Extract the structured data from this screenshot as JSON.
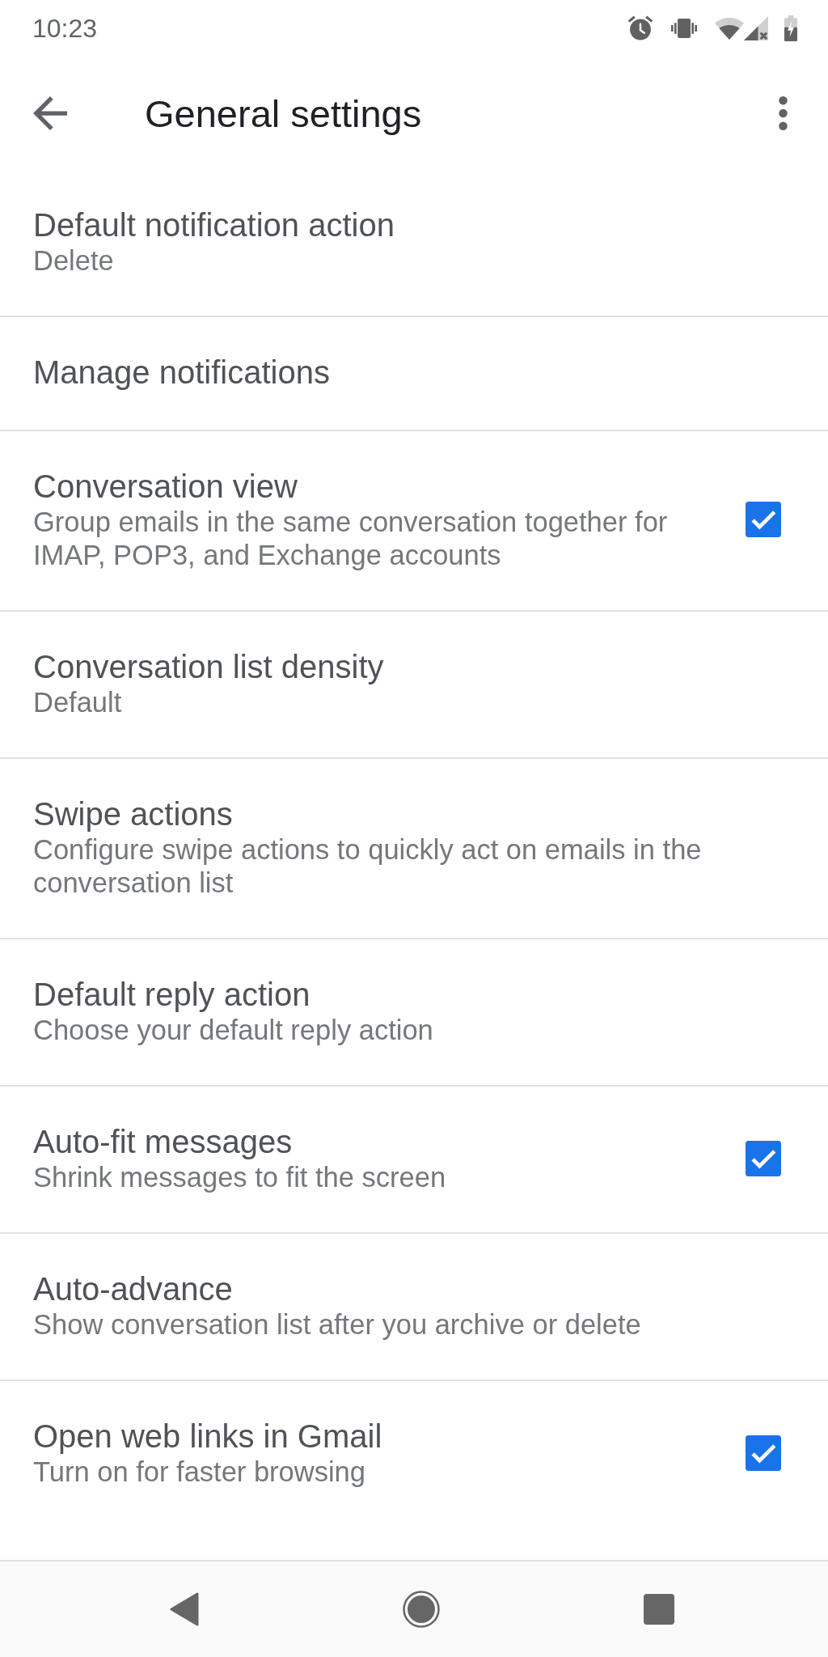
{
  "status_bar": {
    "time": "10:23"
  },
  "app_bar": {
    "title": "General settings"
  },
  "settings": [
    {
      "kind": "text",
      "title": "Default notification action",
      "summary": "Delete"
    },
    {
      "kind": "text",
      "title": "Manage notifications"
    },
    {
      "kind": "checkbox",
      "title": "Conversation view",
      "summary": "Group emails in the same conversation together for IMAP, POP3, and Exchange accounts",
      "checked": true
    },
    {
      "kind": "text",
      "title": "Conversation list density",
      "summary": "Default"
    },
    {
      "kind": "text",
      "title": "Swipe actions",
      "summary": "Configure swipe actions to quickly act on emails in the conversation list"
    },
    {
      "kind": "text",
      "title": "Default reply action",
      "summary": "Choose your default reply action"
    },
    {
      "kind": "checkbox",
      "title": "Auto-fit messages",
      "summary": "Shrink messages to fit the screen",
      "checked": true
    },
    {
      "kind": "text",
      "title": "Auto-advance",
      "summary": "Show conversation list after you archive or delete"
    },
    {
      "kind": "checkbox",
      "title": "Open web links in Gmail",
      "summary": "Turn on for faster browsing",
      "checked": true
    }
  ]
}
